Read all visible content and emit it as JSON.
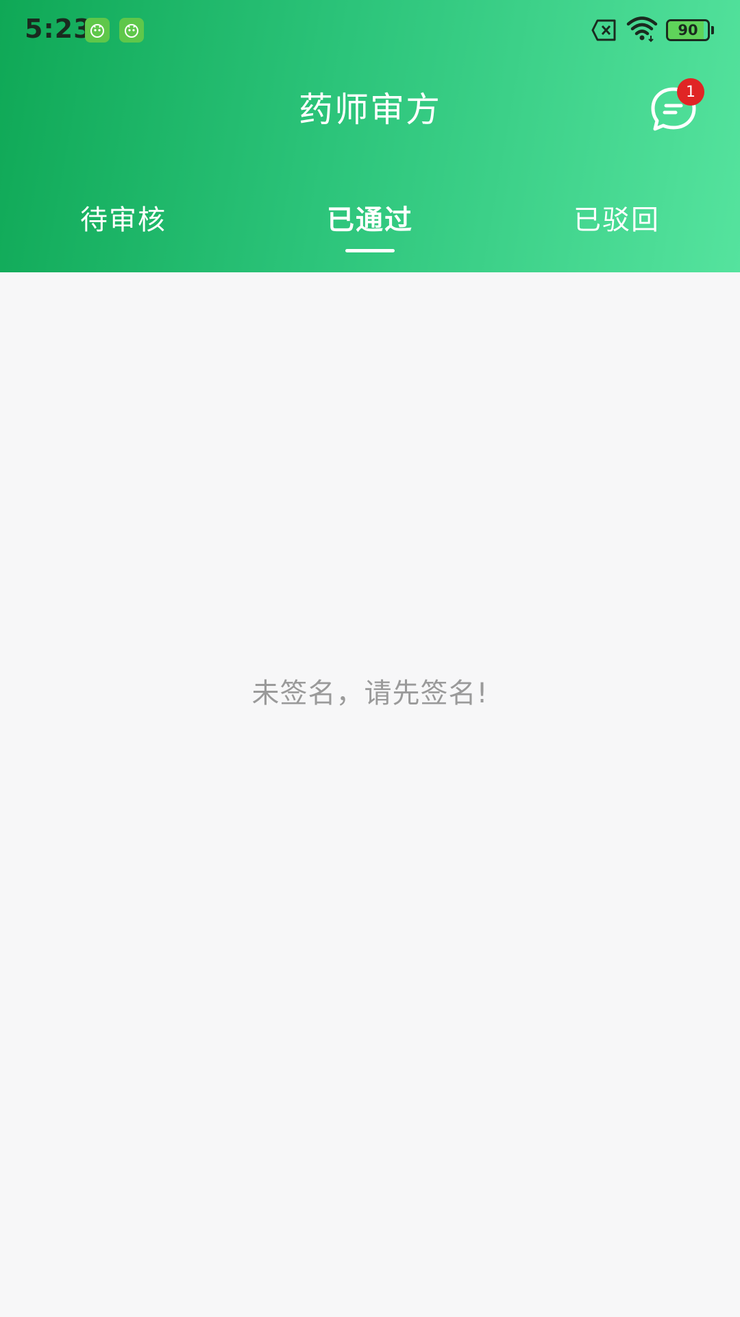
{
  "status_bar": {
    "time": "5:23",
    "battery_level": 90,
    "battery_text": "90",
    "notification_icons": [
      "app-notification-icon",
      "app-notification-icon"
    ]
  },
  "header": {
    "title": "药师审方",
    "message_badge": "1",
    "message_icon": "chat-bubble-icon"
  },
  "tabs": [
    {
      "label": "待审核",
      "active": false
    },
    {
      "label": "已通过",
      "active": true
    },
    {
      "label": "已驳回",
      "active": false
    }
  ],
  "empty_state": {
    "message": "未签名，请先签名!"
  },
  "colors": {
    "header_gradient_start": "#0fa856",
    "header_gradient_end": "#55e39e",
    "badge": "#e02525",
    "background": "#f7f7f8",
    "empty_text": "#9a9a9a"
  }
}
